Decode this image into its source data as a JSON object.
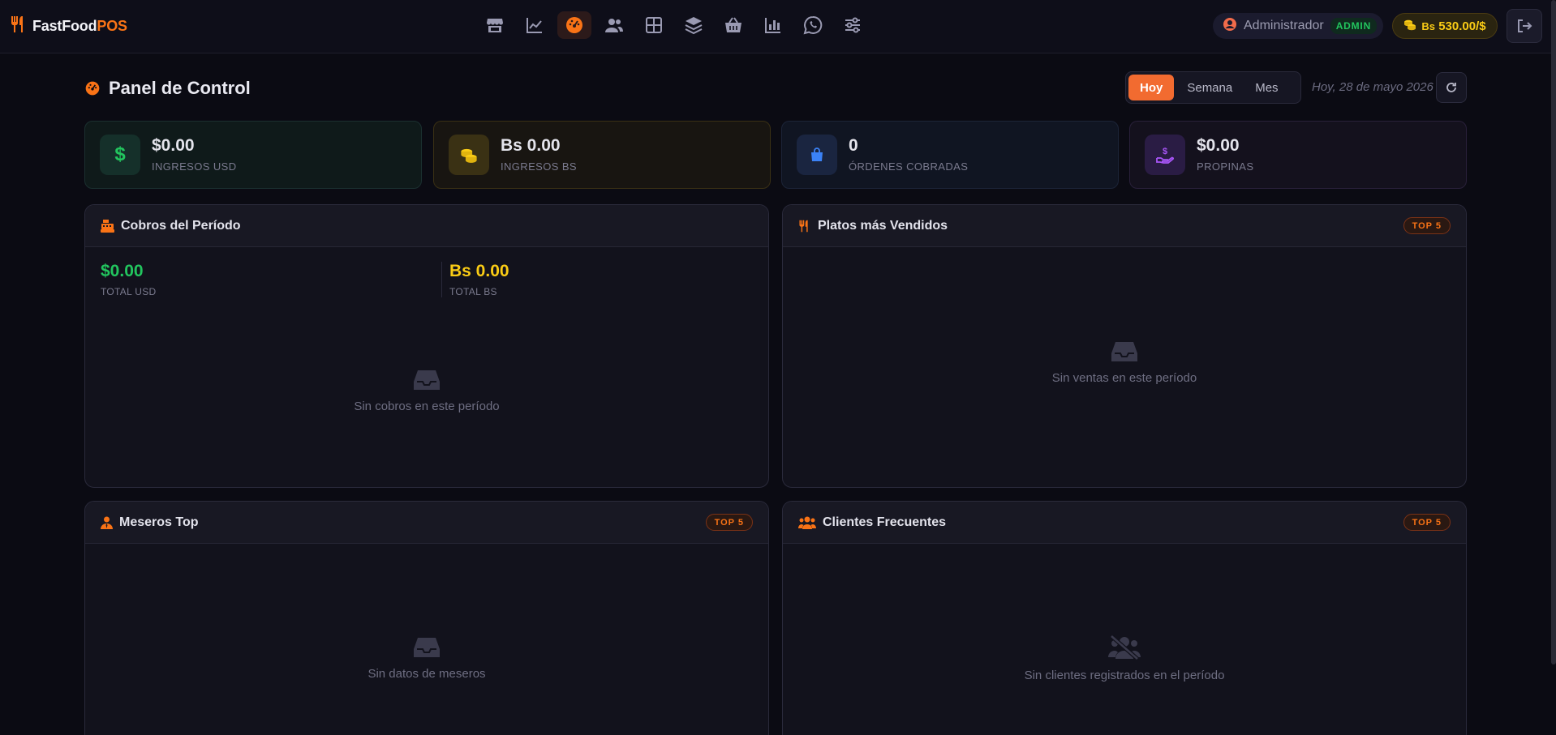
{
  "brand": {
    "name": "FastFood",
    "accent": "POS"
  },
  "nav": {
    "items": [
      "store-icon",
      "chart-line-icon",
      "dashboard-icon",
      "users-icon",
      "table-icon",
      "layers-icon",
      "basket-icon",
      "bar-chart-icon",
      "whatsapp-icon",
      "sliders-icon"
    ],
    "active": "dashboard-icon"
  },
  "user": {
    "name": "Administrador",
    "role": "ADMIN"
  },
  "rate": {
    "prefix": "Bs",
    "value": "530.00/$"
  },
  "page": {
    "title": "Panel de Control",
    "date": "Hoy, 28 de mayo 2026"
  },
  "period": {
    "options": [
      "Hoy",
      "Semana",
      "Mes"
    ],
    "selected": "Hoy"
  },
  "stats": [
    {
      "value": "$0.00",
      "label": "INGRESOS USD",
      "color": "#22c55e"
    },
    {
      "value": "Bs 0.00",
      "label": "INGRESOS BS",
      "color": "#facc15"
    },
    {
      "value": "0",
      "label": "ÓRDENES COBRADAS",
      "color": "#3b82f6"
    },
    {
      "value": "$0.00",
      "label": "PROPINAS",
      "color": "#a855f7"
    }
  ],
  "panels": {
    "cobros": {
      "title": "Cobros del Período",
      "total_usd": "$0.00",
      "total_usd_label": "TOTAL USD",
      "total_bs": "Bs 0.00",
      "total_bs_label": "TOTAL BS",
      "empty": "Sin cobros en este período"
    },
    "platos": {
      "title": "Platos más Vendidos",
      "badge": "TOP 5",
      "empty": "Sin ventas en este período"
    },
    "meseros": {
      "title": "Meseros Top",
      "badge": "TOP 5",
      "empty": "Sin datos de meseros"
    },
    "clientes": {
      "title": "Clientes Frecuentes",
      "badge": "TOP 5",
      "empty": "Sin clientes registrados en el período"
    }
  },
  "colors": {
    "accent": "#f97316",
    "usd": "#22c55e",
    "bs": "#facc15",
    "orders": "#3b82f6",
    "tips": "#a855f7"
  }
}
